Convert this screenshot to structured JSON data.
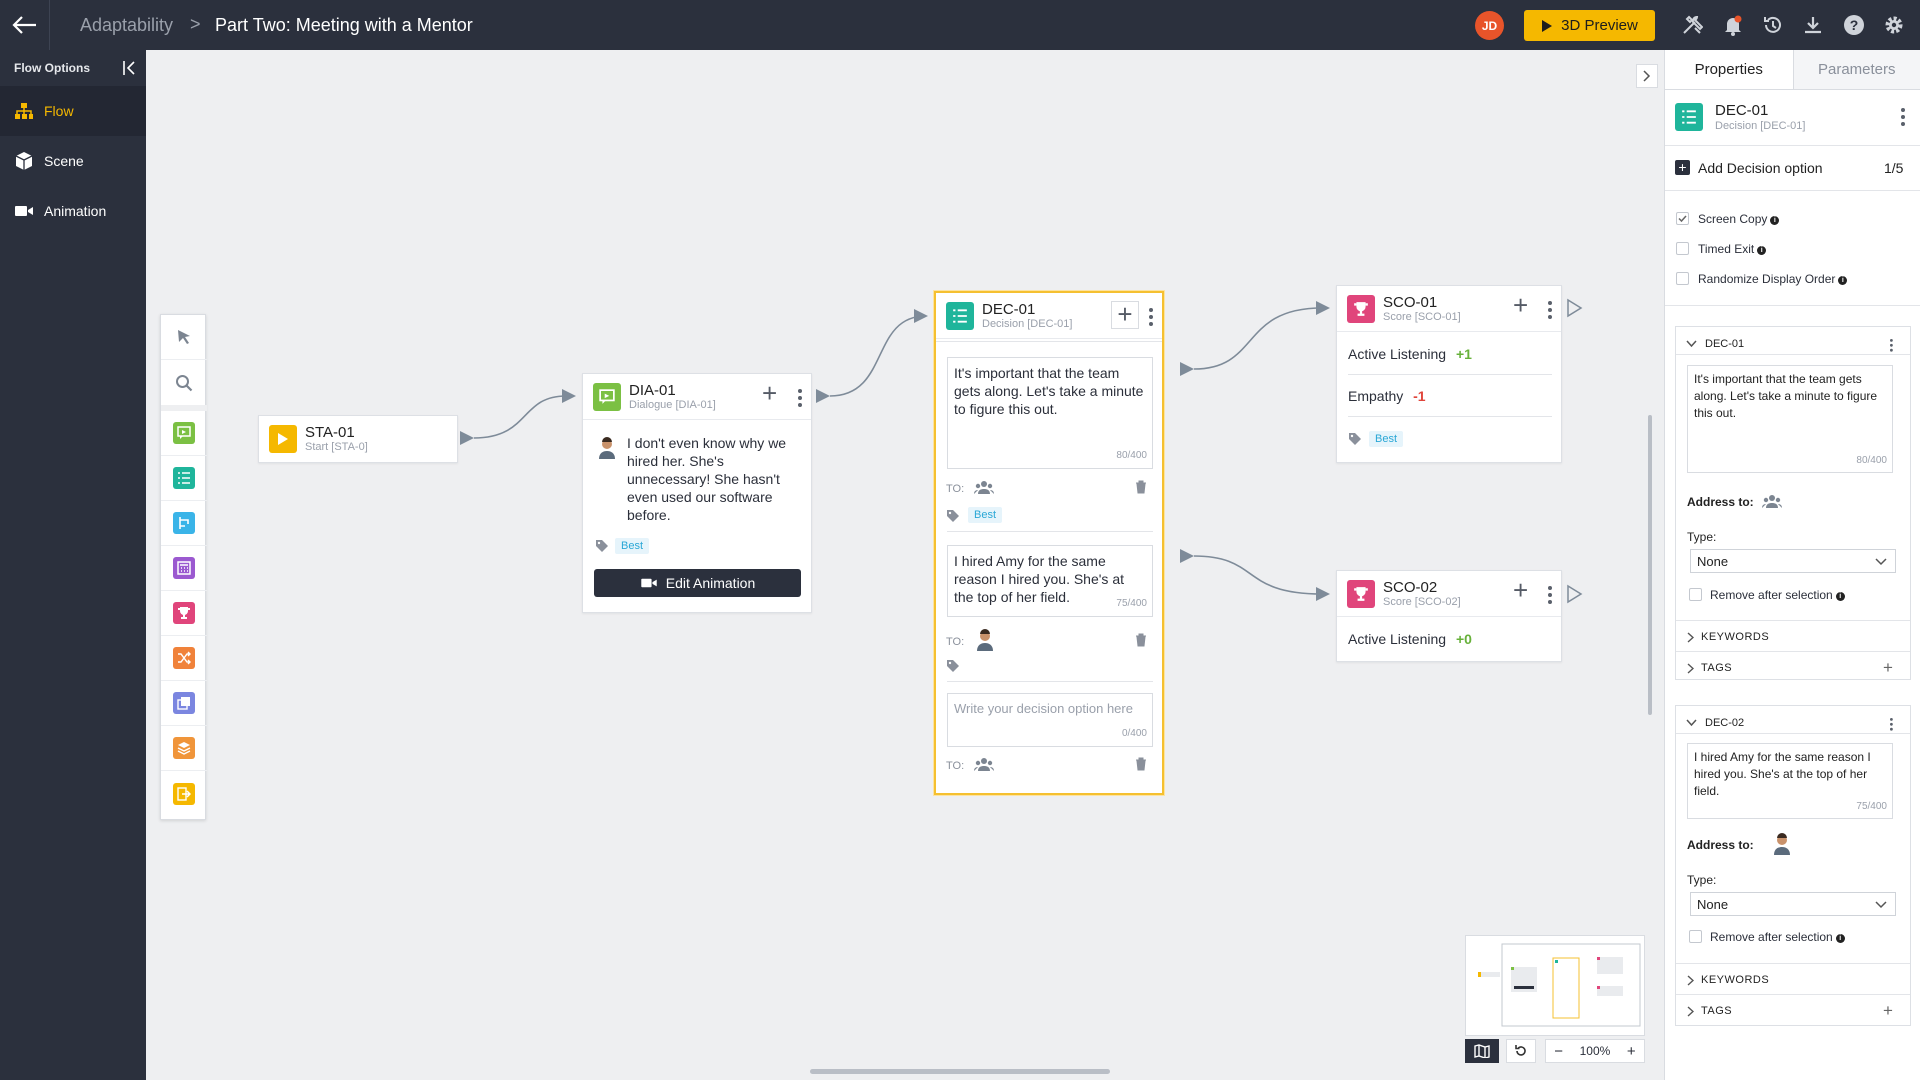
{
  "header": {
    "breadcrumb_root": "Adaptability",
    "breadcrumb_sep": ">",
    "title": "Part Two: Meeting with a Mentor",
    "avatar_initials": "JD",
    "preview_label": "3D Preview",
    "icons": [
      "back-arrow-icon",
      "tools-icon",
      "bell-icon",
      "history-icon",
      "download-icon",
      "help-icon",
      "gear-icon"
    ]
  },
  "leftnav": {
    "heading": "Flow Options",
    "items": [
      {
        "label": "Flow",
        "icon": "flow-icon",
        "active": true
      },
      {
        "label": "Scene",
        "icon": "cube-icon",
        "active": false
      },
      {
        "label": "Animation",
        "icon": "video-icon",
        "active": false
      }
    ]
  },
  "palette": {
    "tools": [
      "pointer-icon",
      "search-icon",
      "dialogue-icon",
      "decision-icon",
      "branch-icon",
      "calculator-icon",
      "trophy-icon",
      "shuffle-icon",
      "copy-icon",
      "layers-icon",
      "exit-icon"
    ]
  },
  "nodes": {
    "start": {
      "title": "STA-01",
      "subtitle": "Start [STA-0]"
    },
    "dialogue": {
      "title": "DIA-01",
      "subtitle": "Dialogue [DIA-01]",
      "text": "I don't even know why we hired her. She's unnecessary! She hasn't even used our software before.",
      "tag": "Best",
      "button": "Edit Animation"
    },
    "decision": {
      "title": "DEC-01",
      "subtitle": "Decision [DEC-01]",
      "options": [
        {
          "text": "It's important that the team gets along. Let's take a minute to figure this out.",
          "count": "80/400",
          "to": "TO:",
          "tag": "Best"
        },
        {
          "text": "I hired Amy for the same reason I hired you. She's at the top of her field.",
          "count": "75/400",
          "to": "TO:"
        }
      ],
      "new_placeholder": "Write your decision option here",
      "new_count": "0/400",
      "new_to": "TO:"
    },
    "score1": {
      "title": "SCO-01",
      "subtitle": "Score [SCO-01]",
      "rows": [
        {
          "label": "Active Listening",
          "value": "+1"
        },
        {
          "label": "Empathy",
          "value": "-1"
        }
      ],
      "tag": "Best"
    },
    "score2": {
      "title": "SCO-02",
      "subtitle": "Score [SCO-02]",
      "rows": [
        {
          "label": "Active Listening",
          "value": "+0"
        }
      ]
    }
  },
  "zoom": {
    "level": "100%",
    "minus": "−",
    "plus": "+"
  },
  "properties": {
    "tabs": [
      "Properties",
      "Parameters"
    ],
    "node_title": "DEC-01",
    "node_subtitle": "Decision [DEC-01]",
    "add_option": "Add Decision option",
    "add_count": "1/5",
    "checks": [
      {
        "label": "Screen Copy",
        "checked": true
      },
      {
        "label": "Timed Exit",
        "checked": false
      },
      {
        "label": "Randomize Display Order",
        "checked": false
      }
    ],
    "options": [
      {
        "title": "DEC-01",
        "text": "It's important that the team gets along. Let's take a minute to figure this out.",
        "count": "80/400",
        "address_label": "Address to:",
        "type_label": "Type:",
        "type_value": "None",
        "remove_label": "Remove after selection",
        "keywords": "KEYWORDS",
        "tags": "TAGS"
      },
      {
        "title": "DEC-02",
        "text": "I hired Amy for the same reason I hired you. She's at the top of her field.",
        "count": "75/400",
        "address_label": "Address to:",
        "type_label": "Type:",
        "type_value": "None",
        "remove_label": "Remove after selection",
        "keywords": "KEYWORDS",
        "tags": "TAGS"
      }
    ]
  },
  "colors": {
    "accent": "#f5b800",
    "topbar": "#2b303d",
    "decision": "#1fb59b",
    "dialogue": "#7bc043",
    "score": "#e0457b",
    "start": "#f5b800"
  }
}
